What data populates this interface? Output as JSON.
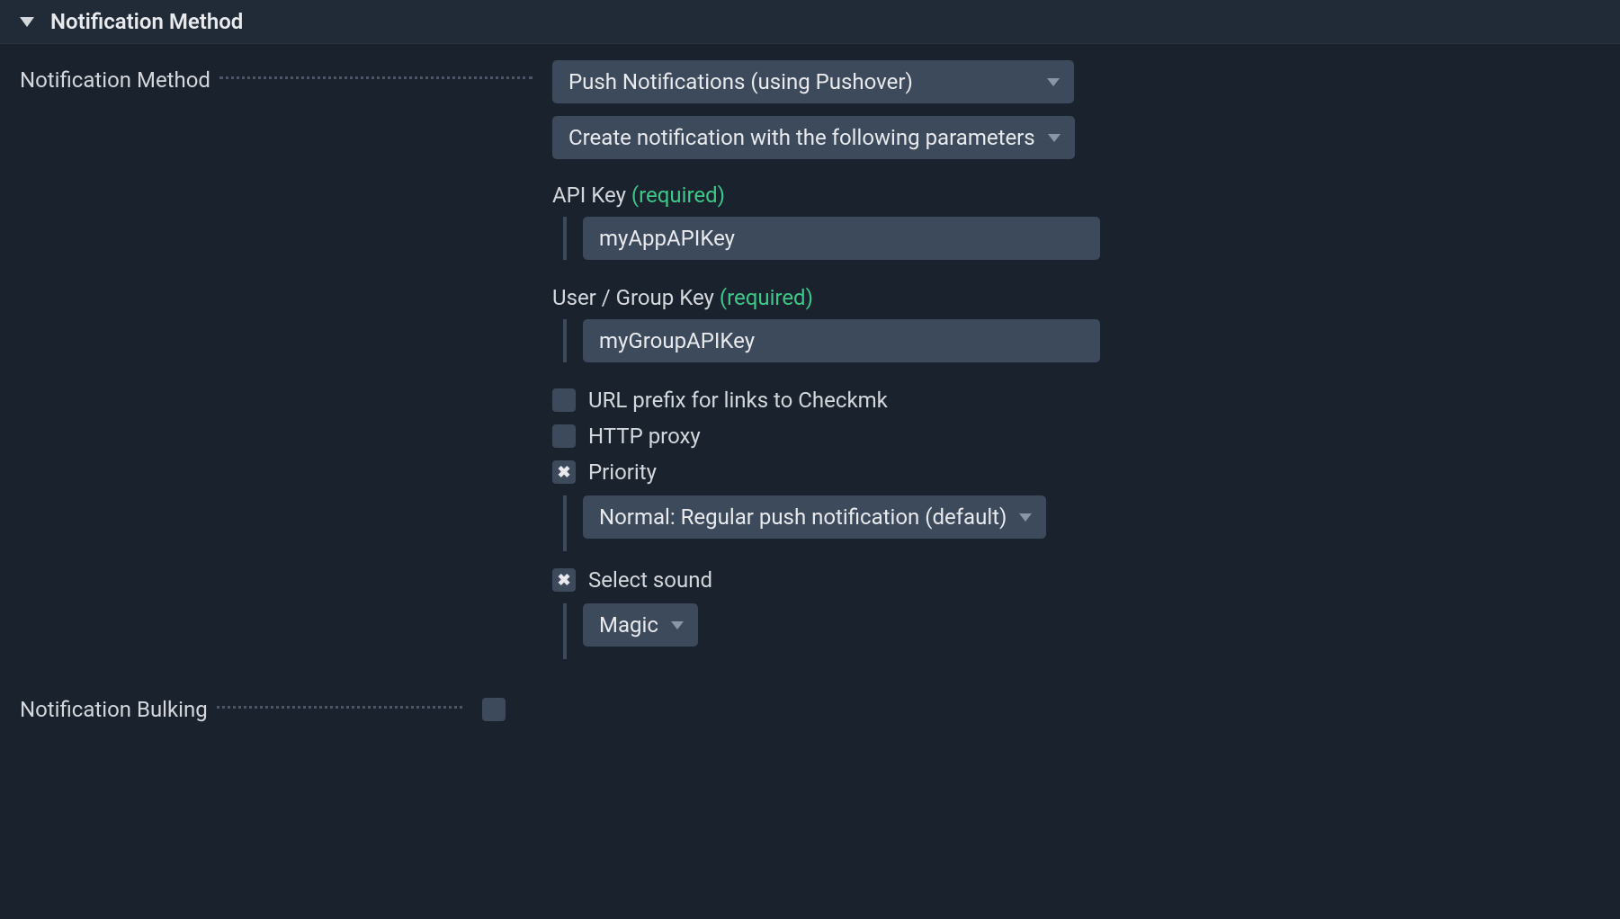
{
  "section": {
    "title": "Notification Method"
  },
  "form": {
    "method_label": "Notification Method",
    "method_dropdown": "Push Notifications (using Pushover)",
    "params_dropdown": "Create notification with the following parameters",
    "api_key": {
      "label": "API Key",
      "required": "(required)",
      "value": "myAppAPIKey"
    },
    "user_group_key": {
      "label": "User / Group Key",
      "required": "(required)",
      "value": "myGroupAPIKey"
    },
    "url_prefix": {
      "label": "URL prefix for links to Checkmk",
      "checked": false
    },
    "http_proxy": {
      "label": "HTTP proxy",
      "checked": false
    },
    "priority": {
      "label": "Priority",
      "checked": true,
      "value": "Normal: Regular push notification (default)"
    },
    "sound": {
      "label": "Select sound",
      "checked": true,
      "value": "Magic"
    },
    "bulking": {
      "label": "Notification Bulking",
      "checked": false
    }
  }
}
